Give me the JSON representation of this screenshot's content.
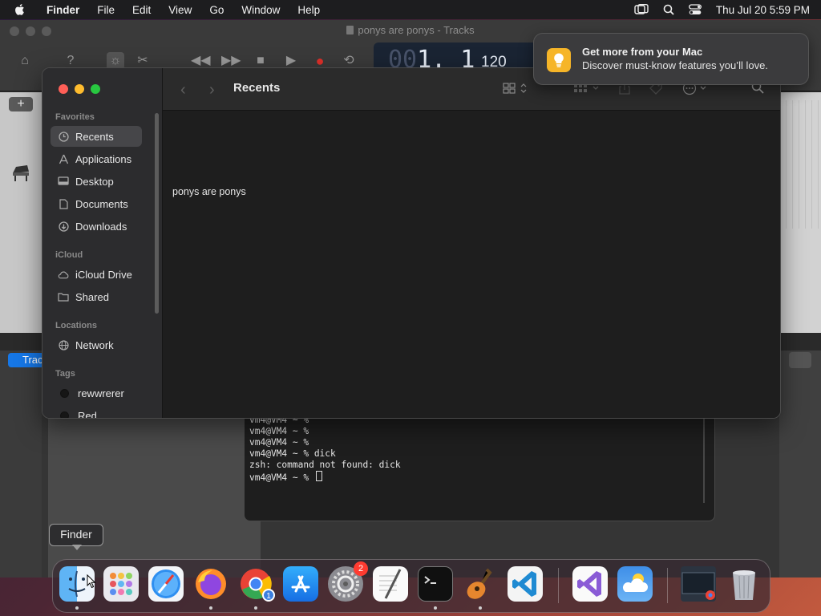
{
  "menubar": {
    "app_name": "Finder",
    "items": [
      "File",
      "Edit",
      "View",
      "Go",
      "Window",
      "Help"
    ],
    "clock": "Thu Jul 20  5:59 PM"
  },
  "garageband": {
    "title": "ponys are ponys - Tracks",
    "lcd_time_dim": "00",
    "lcd_time": "1. 1",
    "tempo": "120",
    "track_button": "Trac"
  },
  "terminal": {
    "lines": [
      "vm4@VM4 ~ %",
      "vm4@VM4 ~ %",
      "vm4@VM4 ~ %",
      "vm4@VM4 ~ % dick",
      "zsh: command not found: dick",
      "vm4@VM4 ~ % "
    ]
  },
  "finder": {
    "title": "Recents",
    "sections": {
      "favorites": "Favorites",
      "icloud": "iCloud",
      "locations": "Locations",
      "tags": "Tags"
    },
    "favorites": [
      "Recents",
      "Applications",
      "Desktop",
      "Documents",
      "Downloads"
    ],
    "icloud_items": [
      "iCloud Drive",
      "Shared"
    ],
    "location_items": [
      "Network"
    ],
    "tag_items": [
      "rewwrerer",
      "Red"
    ],
    "files": [
      "ponys are ponys"
    ]
  },
  "notification": {
    "title": "Get more from your Mac",
    "body": "Discover must-know features you’ll love."
  },
  "tooltip": "Finder",
  "dock": {
    "badges": {
      "system_settings": "2",
      "chrome_download": "1"
    },
    "apps": [
      "finder",
      "launchpad",
      "safari",
      "firefox",
      "chrome",
      "app-store",
      "system-settings",
      "textedit",
      "terminal",
      "garageband",
      "vscode",
      "visual-studio",
      "weather",
      "chrome-window",
      "trash"
    ]
  },
  "colors": {
    "traffic_red": "#ff5f57",
    "traffic_yellow": "#febc2e",
    "traffic_green": "#28c840",
    "accent_blue": "#1677e6",
    "badge_red": "#ff3b30"
  }
}
